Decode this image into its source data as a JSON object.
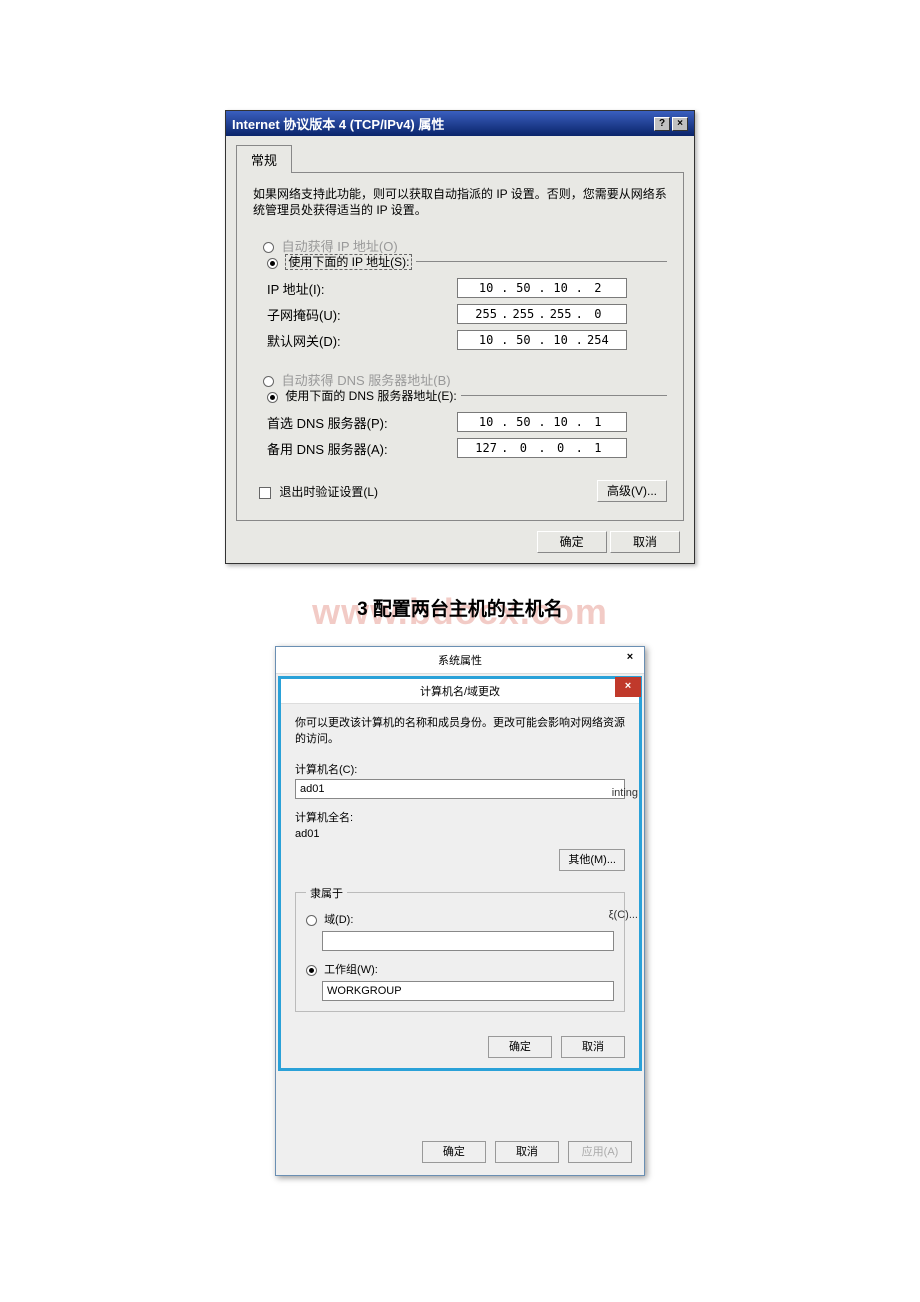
{
  "dlg1": {
    "title": "Internet 协议版本 4 (TCP/IPv4) 属性",
    "tab": "常规",
    "desc": "如果网络支持此功能，则可以获取自动指派的 IP 设置。否则，您需要从网络系统管理员处获得适当的 IP 设置。",
    "opt_auto_ip": "自动获得 IP 地址(O)",
    "opt_manual_ip": "使用下面的 IP 地址(S):",
    "lbl_ip": "IP 地址(I):",
    "lbl_mask": "子网掩码(U):",
    "lbl_gw": "默认网关(D):",
    "ip": {
      "a": "10",
      "b": "50",
      "c": "10",
      "d": "2"
    },
    "mask": {
      "a": "255",
      "b": "255",
      "c": "255",
      "d": "0"
    },
    "gw": {
      "a": "10",
      "b": "50",
      "c": "10",
      "d": "254"
    },
    "opt_auto_dns": "自动获得 DNS 服务器地址(B)",
    "opt_manual_dns": "使用下面的 DNS 服务器地址(E):",
    "lbl_dns1": "首选 DNS 服务器(P):",
    "lbl_dns2": "备用 DNS 服务器(A):",
    "dns1": {
      "a": "10",
      "b": "50",
      "c": "10",
      "d": "1"
    },
    "dns2": {
      "a": "127",
      "b": "0",
      "c": "0",
      "d": "1"
    },
    "chk_exit": "退出时验证设置(L)",
    "btn_adv": "高级(V)...",
    "btn_ok": "确定",
    "btn_cancel": "取消"
  },
  "heading": {
    "watermark": "www.bdocx.com",
    "text": "3 配置两台主机的主机名"
  },
  "dlg2": {
    "title": "系统属性",
    "inner_title": "计算机名/域更改",
    "desc": "你可以更改该计算机的名称和成员身份。更改可能会影响对网络资源的访问。",
    "lbl_name": "计算机名(C):",
    "name_value": "ad01",
    "lbl_fullname": "计算机全名:",
    "fullname_value": "ad01",
    "btn_more": "其他(M)...",
    "grp_member": "隶属于",
    "opt_domain": "域(D):",
    "domain_value": "",
    "opt_workgroup": "工作组(W):",
    "workgroup_value": "WORKGROUP",
    "btn_ok": "确定",
    "btn_cancel": "取消",
    "outer_ok": "确定",
    "outer_cancel": "取消",
    "outer_apply": "应用(A)",
    "side_frag1": "inting",
    "side_frag2": "ξ(C)..."
  }
}
